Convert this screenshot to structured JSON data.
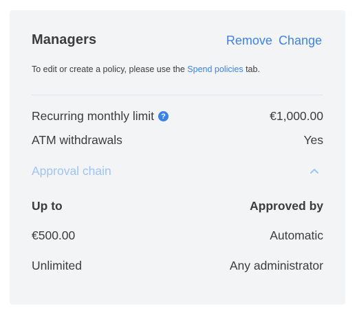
{
  "header": {
    "title": "Managers",
    "remove_label": "Remove",
    "change_label": "Change"
  },
  "note": {
    "prefix": "To edit or create a policy, please use the ",
    "link": "Spend policies",
    "suffix": " tab."
  },
  "details": {
    "monthly_limit_label": "Recurring monthly limit",
    "monthly_limit_value": "€1,000.00",
    "help_icon": "?",
    "atm_label": "ATM withdrawals",
    "atm_value": "Yes"
  },
  "approval_chain": {
    "label": "Approval chain",
    "expanded": true,
    "columns": [
      "Up to",
      "Approved by"
    ],
    "rows": [
      {
        "up_to": "€500.00",
        "approved_by": "Automatic"
      },
      {
        "up_to": "Unlimited",
        "approved_by": "Any administrator"
      }
    ]
  },
  "colors": {
    "accent": "#3b82e6",
    "accent_light": "#9ec4f3",
    "card_bg": "#f3f4f6",
    "text": "#3c3c3c"
  }
}
